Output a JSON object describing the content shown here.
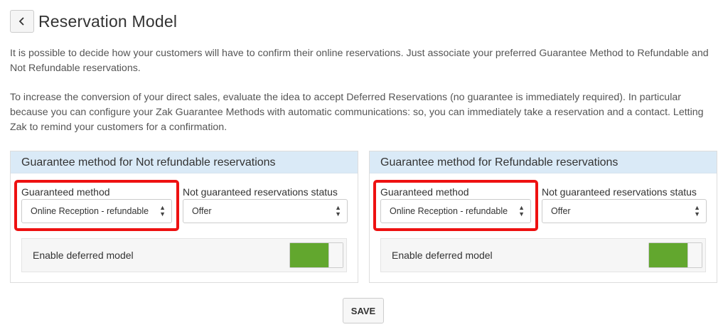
{
  "header": {
    "back_icon": "chevron-left-icon",
    "title": "Reservation Model"
  },
  "description": {
    "paragraph1": "It is possible to decide how your customers will have to confirm their online reservations. Just associate your preferred Guarantee Method to Refundable and Not Refundable reservations.",
    "paragraph2": "To increase the conversion of your direct sales, evaluate the idea to accept Deferred Reservations (no guarantee is immediately required). In particular because you can configure your Zak Guarantee Methods with automatic communications: so, you can immediately take a reservation and a contact. Letting Zak to remind your customers for a confirmation."
  },
  "panels": [
    {
      "title": "Guarantee method for Not refundable reservations",
      "guaranteed_method_label": "Guaranteed method",
      "guaranteed_method_value": "Online Reception - refundable",
      "status_label": "Not guaranteed reservations status",
      "status_value": "Offer",
      "deferred_label": "Enable deferred model",
      "deferred_enabled": true
    },
    {
      "title": "Guarantee method for Refundable reservations",
      "guaranteed_method_label": "Guaranteed method",
      "guaranteed_method_value": "Online Reception - refundable",
      "status_label": "Not guaranteed reservations status",
      "status_value": "Offer",
      "deferred_label": "Enable deferred model",
      "deferred_enabled": true
    }
  ],
  "save_label": "SAVE",
  "colors": {
    "panel_header_bg": "#daeaf7",
    "toggle_on": "#62a72e",
    "highlight": "#ee1111"
  }
}
